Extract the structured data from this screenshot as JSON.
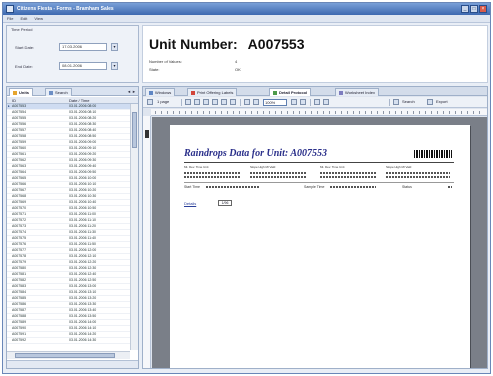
{
  "window": {
    "title": "Citizens Fiesta - Forms - Bramham Sales",
    "buttons": [
      "_",
      "□",
      "×"
    ]
  },
  "menu": [
    "File",
    "Edit",
    "View"
  ],
  "filter": {
    "legend": "Time Period",
    "start_label": "Start Date:",
    "start_value": "17.03.2006",
    "end_label": "End Date:",
    "end_value": "08.01.2006"
  },
  "header": {
    "unit_label": "Unit Number:",
    "unit_value": "A007553",
    "rows": [
      {
        "label": "Number of Values:",
        "value": "4"
      },
      {
        "label": "State:",
        "value": "OK"
      }
    ]
  },
  "left": {
    "tabs": [
      "Units",
      "Search"
    ],
    "nav": "◄ ►",
    "columns": [
      "ID",
      "Date / Time"
    ],
    "rows": [
      [
        "A007553",
        "03.01.2006 08:00"
      ],
      [
        "A007554",
        "03.01.2006 08:10"
      ],
      [
        "A007555",
        "03.01.2006 08:20"
      ],
      [
        "A007556",
        "03.01.2006 08:30"
      ],
      [
        "A007557",
        "03.01.2006 08:40"
      ],
      [
        "A007558",
        "03.01.2006 08:50"
      ],
      [
        "A007559",
        "03.01.2006 09:00"
      ],
      [
        "A007560",
        "03.01.2006 09:10"
      ],
      [
        "A007561",
        "03.01.2006 09:20"
      ],
      [
        "A007562",
        "03.01.2006 09:30"
      ],
      [
        "A007563",
        "03.01.2006 09:40"
      ],
      [
        "A007564",
        "03.01.2006 09:50"
      ],
      [
        "A007565",
        "03.01.2006 10:00"
      ],
      [
        "A007566",
        "03.01.2006 10:10"
      ],
      [
        "A007567",
        "03.01.2006 10:20"
      ],
      [
        "A007568",
        "03.01.2006 10:30"
      ],
      [
        "A007569",
        "03.01.2006 10:40"
      ],
      [
        "A007570",
        "03.01.2006 10:50"
      ],
      [
        "A007571",
        "03.01.2006 11:00"
      ],
      [
        "A007572",
        "03.01.2006 11:10"
      ],
      [
        "A007573",
        "03.01.2006 11:20"
      ],
      [
        "A007574",
        "03.01.2006 11:30"
      ],
      [
        "A007575",
        "03.01.2006 11:40"
      ],
      [
        "A007576",
        "03.01.2006 11:50"
      ],
      [
        "A007577",
        "03.01.2006 12:00"
      ],
      [
        "A007578",
        "03.01.2006 12:10"
      ],
      [
        "A007579",
        "03.01.2006 12:20"
      ],
      [
        "A007580",
        "03.01.2006 12:30"
      ],
      [
        "A007581",
        "03.01.2006 12:40"
      ],
      [
        "A007582",
        "03.01.2006 12:50"
      ],
      [
        "A007583",
        "03.01.2006 13:00"
      ],
      [
        "A007584",
        "03.01.2006 13:10"
      ],
      [
        "A007585",
        "03.01.2006 13:20"
      ],
      [
        "A007586",
        "03.01.2006 13:30"
      ],
      [
        "A007587",
        "03.01.2006 13:40"
      ],
      [
        "A007588",
        "03.01.2006 13:50"
      ],
      [
        "A007589",
        "03.01.2006 14:00"
      ],
      [
        "A007590",
        "03.01.2006 14:10"
      ],
      [
        "A007591",
        "03.01.2006 14:20"
      ],
      [
        "A007592",
        "03.01.2006 14:30"
      ]
    ]
  },
  "right": {
    "tabs": [
      "Windows",
      "Print Offering Labels",
      "Detail Protocol",
      "Worksheet Index"
    ],
    "toolbar": {
      "page_label": "1 page",
      "zoom": "100%",
      "search_label": "Search",
      "export_label": "Export"
    },
    "report": {
      "title": "Raindrops Data for Unit: A007553",
      "col_headers_a": "Mt.  Dev.  Time   Unit",
      "col_headers_b": "Slope  High  Ml   Vald",
      "col_headers_c": "Mt.  Dev.  Time   Unit",
      "col_headers_d": "Slope  High  Ml   Vald",
      "row1_left": "Start Time",
      "row1_mid": "Sample Time",
      "row1_right": "Status",
      "details_label": "Details",
      "details_value": "1/96"
    }
  },
  "colors": {
    "titlebar": "#3d69b0",
    "panel": "#e9eef6",
    "report_title": "#2a2f8a",
    "selection": "#cfdcf1"
  }
}
